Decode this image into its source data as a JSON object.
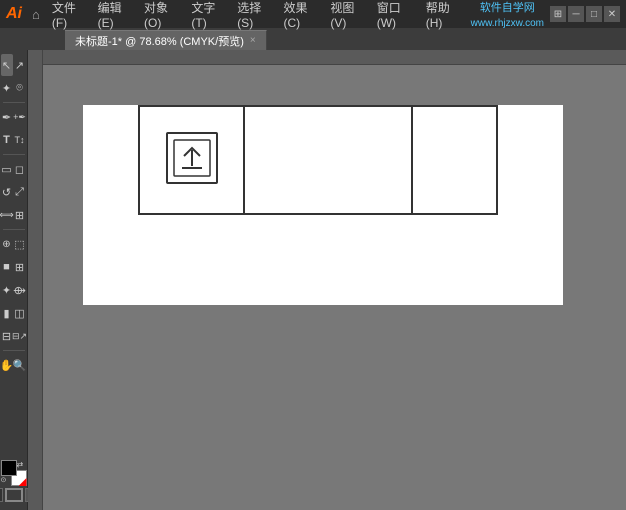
{
  "titlebar": {
    "logo": "Ai",
    "menus": [
      "文件(F)",
      "编辑(E)",
      "对象(O)",
      "文字(T)",
      "选择(S)",
      "效果(C)",
      "视图(V)",
      "窗口(W)",
      "帮助(H)"
    ],
    "watermark": "www.rhjzxw.com",
    "window_buttons": [
      "▪",
      "▪",
      "✕"
    ]
  },
  "tab": {
    "title": "未标题-1* @ 78.68% (CMYK/预览)",
    "close": "×"
  },
  "tools": [
    {
      "name": "selection-tool",
      "icon": "↖",
      "active": true
    },
    {
      "name": "direct-selection-tool",
      "icon": "↗"
    },
    {
      "name": "magic-wand-tool",
      "icon": "✦"
    },
    {
      "name": "lasso-tool",
      "icon": "⌾"
    },
    {
      "name": "pen-tool",
      "icon": "✒"
    },
    {
      "name": "add-anchor-tool",
      "icon": "+"
    },
    {
      "name": "type-tool",
      "icon": "T"
    },
    {
      "name": "touch-type-tool",
      "icon": "T"
    },
    {
      "name": "rectangle-tool",
      "icon": "▭"
    },
    {
      "name": "eraser-tool",
      "icon": "◻"
    },
    {
      "name": "rotate-tool",
      "icon": "↺"
    },
    {
      "name": "scale-tool",
      "icon": "⤢"
    },
    {
      "name": "width-tool",
      "icon": "⟺"
    },
    {
      "name": "free-transform-tool",
      "icon": "⊞"
    },
    {
      "name": "shape-builder-tool",
      "icon": "⊕"
    },
    {
      "name": "perspective-grid-tool",
      "icon": "⬚"
    },
    {
      "name": "gradient-tool",
      "icon": "■"
    },
    {
      "name": "mesh-tool",
      "icon": "⊞"
    },
    {
      "name": "eyedropper-tool",
      "icon": "✦"
    },
    {
      "name": "blend-tool",
      "icon": "⟴"
    },
    {
      "name": "graph-tool",
      "icon": "▮"
    },
    {
      "name": "artboard-tool",
      "icon": "◫"
    },
    {
      "name": "slice-tool",
      "icon": "⊟"
    },
    {
      "name": "hand-tool",
      "icon": "✋"
    },
    {
      "name": "zoom-tool",
      "icon": "🔍"
    }
  ],
  "colors": {
    "fg": "black",
    "bg": "white"
  },
  "canvas": {
    "zoom": "78.68%",
    "colormode": "CMYK/预览"
  },
  "table": {
    "columns": 3,
    "has_upload_icon": true
  }
}
